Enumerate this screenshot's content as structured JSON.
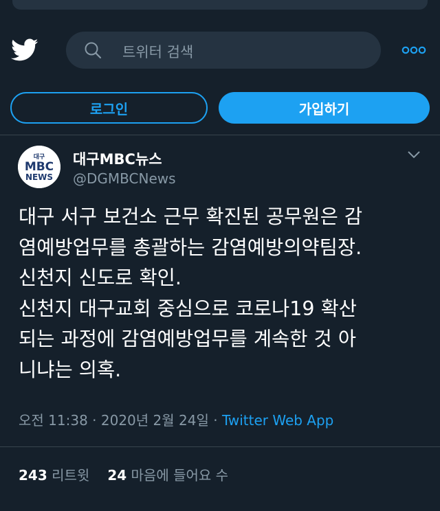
{
  "header": {
    "search_placeholder": "트위터 검색",
    "icons": [
      "twitter-bird-icon",
      "search-icon",
      "more-icon"
    ]
  },
  "auth": {
    "login_label": "로그인",
    "signup_label": "가입하기"
  },
  "tweet": {
    "author_name": "대구MBC뉴스",
    "author_handle": "@DGMBCNews",
    "avatar_text": {
      "top": "대구",
      "middle": "MBC",
      "bottom": "NEWS"
    },
    "text_lines": [
      "대구 서구 보건소 근무 확진된 공무원은 감",
      "염예방업무를 총괄하는 감염예방의약팀장.",
      "신천지 신도로 확인.",
      "신천지 대구교회 중심으로 코로나19 확산",
      "되는 과정에 감염예방업무를 계속한 것 아",
      "니냐는 의혹."
    ],
    "time": "오전 11:38",
    "separator": "·",
    "date": "2020년 2월 24일",
    "source": "Twitter Web App",
    "retweets_count": "243",
    "retweets_label": "리트윗",
    "likes_count": "24",
    "likes_label": "마음에 들어요 수"
  },
  "colors": {
    "background": "#15202b",
    "accent": "#1da1f2",
    "muted_text": "#8899a6",
    "divider": "#38444d",
    "search_bg": "#253341"
  }
}
